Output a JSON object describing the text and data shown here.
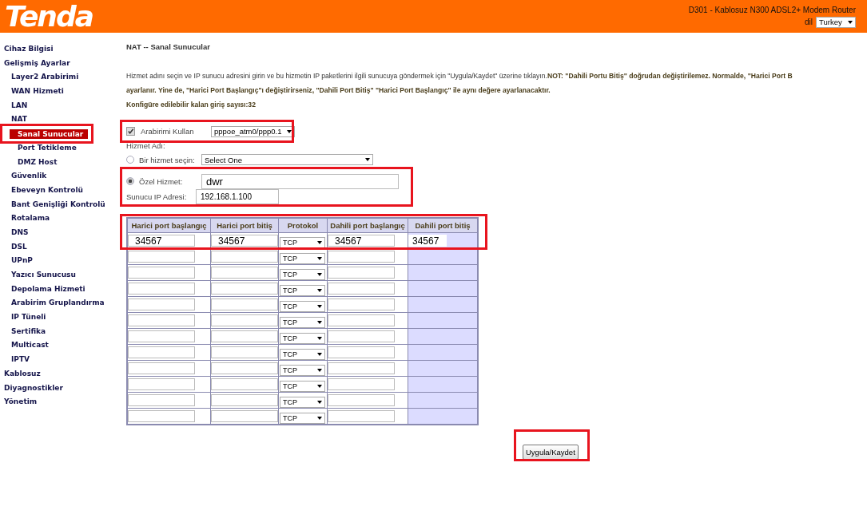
{
  "header": {
    "logo": "Tenda",
    "product": "D301 - Kablosuz N300 ADSL2+ Modem Router",
    "language_label": "dil",
    "language": "Turkey"
  },
  "sidebar": {
    "items": [
      {
        "label": "Cihaz Bilgisi",
        "selected": false
      },
      {
        "label": "Gelişmiş Ayarlar",
        "selected": false,
        "children": [
          {
            "label": "Layer2 Arabirimi",
            "selected": false
          },
          {
            "label": "WAN Hizmeti",
            "selected": false
          },
          {
            "label": "LAN",
            "selected": false
          },
          {
            "label": "NAT",
            "selected": false,
            "children": [
              {
                "label": "Sanal Sunucular",
                "selected": true
              },
              {
                "label": "Port Tetikleme",
                "selected": false
              },
              {
                "label": "DMZ Host",
                "selected": false
              }
            ]
          },
          {
            "label": "Güvenlik",
            "selected": false
          },
          {
            "label": "Ebeveyn Kontrolü",
            "selected": false
          },
          {
            "label": "Bant Genişliği Kontrolü",
            "selected": false
          },
          {
            "label": "Rotalama",
            "selected": false
          },
          {
            "label": "DNS",
            "selected": false
          },
          {
            "label": "DSL",
            "selected": false
          },
          {
            "label": "UPnP",
            "selected": false
          },
          {
            "label": "Yazıcı Sunucusu",
            "selected": false
          },
          {
            "label": "Depolama Hizmeti",
            "selected": false
          },
          {
            "label": "Arabirim Gruplandırma",
            "selected": false
          },
          {
            "label": "IP Tüneli",
            "selected": false
          },
          {
            "label": "Sertifika",
            "selected": false
          },
          {
            "label": "Multicast",
            "selected": false
          },
          {
            "label": "IPTV",
            "selected": false
          }
        ]
      },
      {
        "label": "Kablosuz",
        "selected": false
      },
      {
        "label": "Diyagnostikler",
        "selected": false
      },
      {
        "label": "Yönetim",
        "selected": false
      }
    ]
  },
  "page_title": "NAT -- Sanal Sunucular",
  "description": [
    "Hizmet adını seçin ve IP sunucu adresini girin ve bu hizmetin IP paketlerini ilgili sunucuya göndermek için \"Uygula/Kaydet\" üzerine tıklayın.**NOT: \"Dahili Portu Bitiş\" doğrudan değiştirilemez. Normalde, \"Harici Port B**",
    "ayarlanır. Yine de, \"Harici Port Başlangıç\"ı değiştirirseniz, \"Dahili Port Bitiş\" \"Harici Port Başlangıç\" ile aynı değere ayarlanacaktır.",
    "Konfigüre edilebilir kalan giriş sayısı:32"
  ],
  "use_interface": {
    "label": "Arabirimi Kullan",
    "checked": true,
    "value": "pppoe_atm0/ppp0.1"
  },
  "service_name_label": "Hizmet Adı:",
  "service_options": [
    {
      "kind": "select",
      "label": "Bir hizmet seçin:",
      "selected": false,
      "value": "Select One"
    },
    {
      "kind": "input",
      "label": "Özel Hizmet:",
      "selected": true,
      "value": "dwr"
    }
  ],
  "server_ip": {
    "label": "Sunucu IP Adresi:",
    "value": "192.168.1.100"
  },
  "table": {
    "columns": [
      "Harici port başlangıç",
      "Harici port bitiş",
      "Protokol",
      "Dahili port başlangıç",
      "Dahili port bitiş"
    ],
    "rows": [
      {
        "ext_start": "34567",
        "ext_end": "34567",
        "protocol": "TCP",
        "int_start": "34567",
        "int_end": "34567"
      },
      {
        "protocol": "TCP"
      },
      {
        "protocol": "TCP"
      },
      {
        "protocol": "TCP"
      },
      {
        "protocol": "TCP"
      },
      {
        "protocol": "TCP"
      },
      {
        "protocol": "TCP"
      },
      {
        "protocol": "TCP"
      },
      {
        "protocol": "TCP"
      },
      {
        "protocol": "TCP"
      },
      {
        "protocol": "TCP"
      },
      {
        "protocol": "TCP"
      }
    ]
  },
  "apply_button": "Uygula/Kaydet"
}
